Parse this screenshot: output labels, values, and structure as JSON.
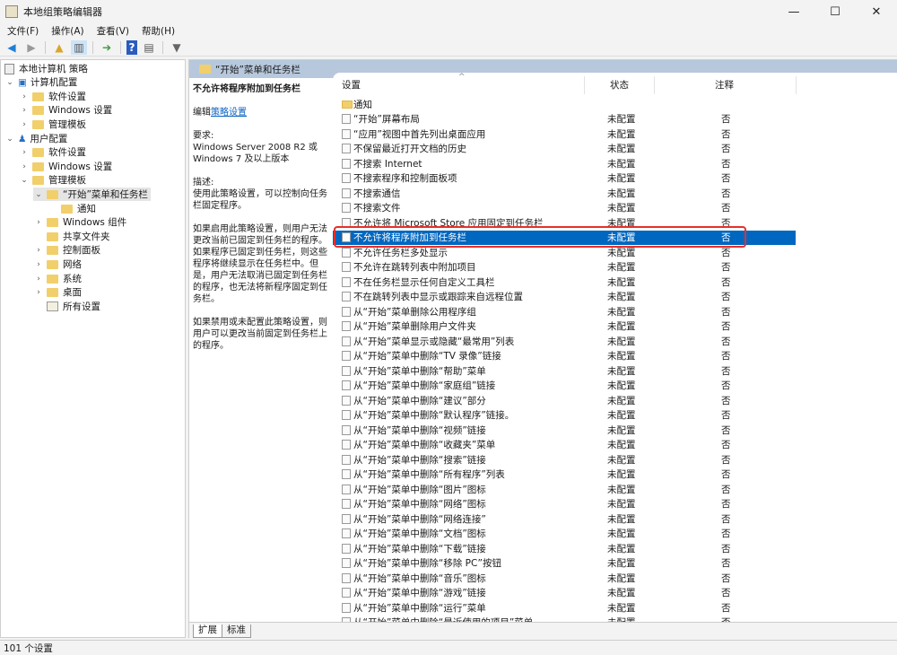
{
  "window": {
    "title": "本地组策略编辑器",
    "minimize": "—",
    "maximize": "☐",
    "close": "✕"
  },
  "menu": [
    "文件(F)",
    "操作(A)",
    "查看(V)",
    "帮助(H)"
  ],
  "toolbar": {
    "icons": [
      "back-icon",
      "forward-icon",
      "up-folder-icon",
      "show-hide-tree-icon",
      "export-icon",
      "help-icon",
      "properties-icon",
      "filter-icon"
    ]
  },
  "tree": {
    "root": "本地计算机 策略",
    "computer": "计算机配置",
    "user": "用户配置",
    "computer_children": [
      "软件设置",
      "Windows 设置",
      "管理模板"
    ],
    "user_children": [
      "软件设置",
      "Windows 设置",
      "管理模板"
    ],
    "admin_children": [
      "“开始”菜单和任务栏",
      "通知",
      "Windows 组件",
      "共享文件夹",
      "控制面板",
      "网络",
      "系统",
      "桌面",
      "所有设置"
    ]
  },
  "header": {
    "folder": "“开始”菜单和任务栏"
  },
  "description": {
    "title": "不允许将程序附加到任务栏",
    "edit_prefix": "编辑",
    "edit_link": "策略设置",
    "req_label": "要求:",
    "req_text": "Windows Server 2008 R2 或 Windows 7 及以上版本",
    "desc_label": "描述:",
    "p1": "使用此策略设置，可以控制向任务栏固定程序。",
    "p2": "如果启用此策略设置，则用户无法更改当前已固定到任务栏的程序。如果程序已固定到任务栏，则这些程序将继续显示在任务栏中。但是，用户无法取消已固定到任务栏的程序，也无法将新程序固定到任务栏。",
    "p3": "如果禁用或未配置此策略设置，则用户可以更改当前固定到任务栏上的程序。"
  },
  "list": {
    "columns": [
      "设置",
      "状态",
      "注释"
    ],
    "selected_index": 9,
    "rows": [
      {
        "name": "通知",
        "state": "",
        "comment": "",
        "folder": true
      },
      {
        "name": "“开始”屏幕布局",
        "state": "未配置",
        "comment": "否"
      },
      {
        "name": "“应用”视图中首先列出桌面应用",
        "state": "未配置",
        "comment": "否"
      },
      {
        "name": "不保留最近打开文档的历史",
        "state": "未配置",
        "comment": "否"
      },
      {
        "name": "不搜索 Internet",
        "state": "未配置",
        "comment": "否"
      },
      {
        "name": "不搜索程序和控制面板项",
        "state": "未配置",
        "comment": "否"
      },
      {
        "name": "不搜索通信",
        "state": "未配置",
        "comment": "否"
      },
      {
        "name": "不搜索文件",
        "state": "未配置",
        "comment": "否"
      },
      {
        "name": "不允许将 Microsoft Store 应用固定到任务栏",
        "state": "未配置",
        "comment": "否"
      },
      {
        "name": "不允许将程序附加到任务栏",
        "state": "未配置",
        "comment": "否"
      },
      {
        "name": "不允许任务栏多处显示",
        "state": "未配置",
        "comment": "否"
      },
      {
        "name": "不允许在跳转列表中附加项目",
        "state": "未配置",
        "comment": "否"
      },
      {
        "name": "不在任务栏显示任何自定义工具栏",
        "state": "未配置",
        "comment": "否"
      },
      {
        "name": "不在跳转列表中显示或跟踪来自远程位置",
        "state": "未配置",
        "comment": "否"
      },
      {
        "name": "从“开始”菜单删除公用程序组",
        "state": "未配置",
        "comment": "否"
      },
      {
        "name": "从“开始”菜单删除用户文件夹",
        "state": "未配置",
        "comment": "否"
      },
      {
        "name": "从“开始”菜单显示或隐藏“最常用”列表",
        "state": "未配置",
        "comment": "否"
      },
      {
        "name": "从“开始”菜单中删除“TV 录像”链接",
        "state": "未配置",
        "comment": "否"
      },
      {
        "name": "从“开始”菜单中删除“帮助”菜单",
        "state": "未配置",
        "comment": "否"
      },
      {
        "name": "从“开始”菜单中删除“家庭组”链接",
        "state": "未配置",
        "comment": "否"
      },
      {
        "name": "从“开始”菜单中删除“建议”部分",
        "state": "未配置",
        "comment": "否"
      },
      {
        "name": "从“开始”菜单中删除“默认程序”链接。",
        "state": "未配置",
        "comment": "否"
      },
      {
        "name": "从“开始”菜单中删除“视频”链接",
        "state": "未配置",
        "comment": "否"
      },
      {
        "name": "从“开始”菜单中删除“收藏夹”菜单",
        "state": "未配置",
        "comment": "否"
      },
      {
        "name": "从“开始”菜单中删除“搜索”链接",
        "state": "未配置",
        "comment": "否"
      },
      {
        "name": "从“开始”菜单中删除“所有程序”列表",
        "state": "未配置",
        "comment": "否"
      },
      {
        "name": "从“开始”菜单中删除“图片”图标",
        "state": "未配置",
        "comment": "否"
      },
      {
        "name": "从“开始”菜单中删除“网络”图标",
        "state": "未配置",
        "comment": "否"
      },
      {
        "name": "从“开始”菜单中删除“网络连接”",
        "state": "未配置",
        "comment": "否"
      },
      {
        "name": "从“开始”菜单中删除“文档”图标",
        "state": "未配置",
        "comment": "否"
      },
      {
        "name": "从“开始”菜单中删除“下载”链接",
        "state": "未配置",
        "comment": "否"
      },
      {
        "name": "从“开始”菜单中删除“移除 PC”按钮",
        "state": "未配置",
        "comment": "否"
      },
      {
        "name": "从“开始”菜单中删除“音乐”图标",
        "state": "未配置",
        "comment": "否"
      },
      {
        "name": "从“开始”菜单中删除“游戏”链接",
        "state": "未配置",
        "comment": "否"
      },
      {
        "name": "从“开始”菜单中删除“运行”菜单",
        "state": "未配置",
        "comment": "否"
      },
      {
        "name": "从“开始”菜单中删除“最近使用的项目”菜单",
        "state": "未配置",
        "comment": "否"
      }
    ]
  },
  "tabs": [
    "扩展",
    "标准"
  ],
  "status": "101 个设置",
  "colors": {
    "selection": "#0067c0",
    "highlight_box": "#e5302b",
    "header_band": "#b7c8dd"
  }
}
